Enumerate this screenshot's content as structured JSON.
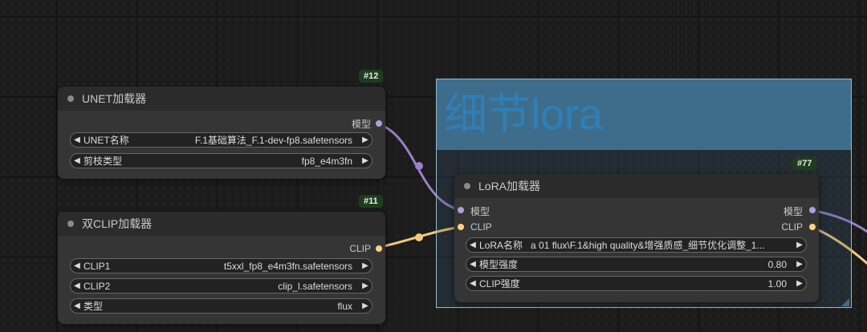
{
  "canvas": {
    "background": "#1c1c1c"
  },
  "group": {
    "title": "细节lora",
    "color": "#3e6d8c"
  },
  "nodes": {
    "unet": {
      "id": "#12",
      "title": "UNET加载器",
      "outputs": [
        {
          "label": "模型",
          "color": "#b39ddb"
        }
      ],
      "widgets": [
        {
          "label": "UNET名称",
          "value": "F.1基础算法_F.1-dev-fp8.safetensors"
        },
        {
          "label": "剪枝类型",
          "value": "fp8_e4m3fn"
        }
      ]
    },
    "dualclip": {
      "id": "#11",
      "title": "双CLIP加载器",
      "outputs": [
        {
          "label": "CLIP",
          "color": "#ffd27f"
        }
      ],
      "widgets": [
        {
          "label": "CLIP1",
          "value": "t5xxl_fp8_e4m3fn.safetensors"
        },
        {
          "label": "CLIP2",
          "value": "clip_l.safetensors"
        },
        {
          "label": "类型",
          "value": "flux"
        }
      ]
    },
    "lora": {
      "id": "#77",
      "title": "LoRA加载器",
      "inputs": [
        {
          "label": "模型",
          "color": "#b39ddb"
        },
        {
          "label": "CLIP",
          "color": "#ffd27f"
        }
      ],
      "outputs": [
        {
          "label": "模型",
          "color": "#b39ddb"
        },
        {
          "label": "CLIP",
          "color": "#ffd27f"
        }
      ],
      "widgets": [
        {
          "label": "LoRA名称",
          "value": "a 01 flux\\F.1&high quality&增强质感_细节优化调整_1..."
        },
        {
          "label": "模型强度",
          "value": "0.80"
        },
        {
          "label": "CLIP强度",
          "value": "1.00"
        }
      ]
    }
  },
  "links": {
    "model_color": "#9b7fc8",
    "clip_color": "#f3c97a"
  },
  "icons": {
    "left": "◀",
    "right": "▶"
  }
}
